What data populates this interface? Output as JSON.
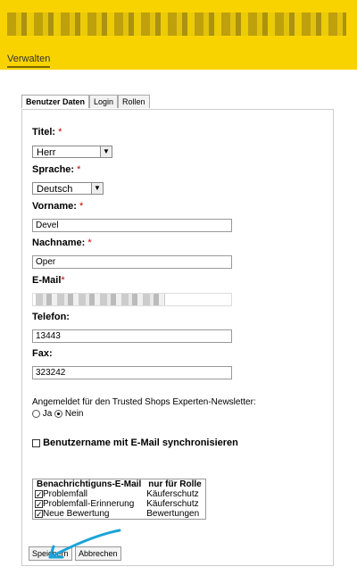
{
  "header": {
    "nav_label": "Verwalten"
  },
  "tabs": [
    {
      "label": "Benutzer Daten",
      "active": true
    },
    {
      "label": "Login",
      "active": false
    },
    {
      "label": "Rollen",
      "active": false
    }
  ],
  "form": {
    "title_label": "Titel:",
    "title_value": "Herr",
    "language_label": "Sprache:",
    "language_value": "Deutsch",
    "firstname_label": "Vorname:",
    "firstname_value": "Devel",
    "lastname_label": "Nachname:",
    "lastname_value": "Oper",
    "email_label": "E-Mail",
    "phone_label": "Telefon:",
    "phone_value": "13443",
    "fax_label": "Fax:",
    "fax_value": "323242",
    "required_mark": "*",
    "newsletter_text": "Angemeldet für den Trusted Shops Experten-Newsletter:",
    "newsletter_yes": "Ja",
    "newsletter_no": "Nein",
    "sync_label": "Benutzername mit E-Mail synchronisieren"
  },
  "notifications": {
    "col_email": "Benachrichtiguns-E-Mail",
    "col_role": "nur für Rolle",
    "rows": [
      {
        "name": "Problemfall",
        "role": "Käuferschutz",
        "checked": true
      },
      {
        "name": "Problemfall-Erinnerung",
        "role": "Käuferschutz",
        "checked": true
      },
      {
        "name": "Neue Bewertung",
        "role": "Bewertungen",
        "checked": true
      }
    ]
  },
  "buttons": {
    "save": "Speichern",
    "cancel": "Abbrechen"
  },
  "colors": {
    "header_bg": "#f9d300",
    "required": "#cc0000",
    "arrow": "#1aa3d9"
  }
}
